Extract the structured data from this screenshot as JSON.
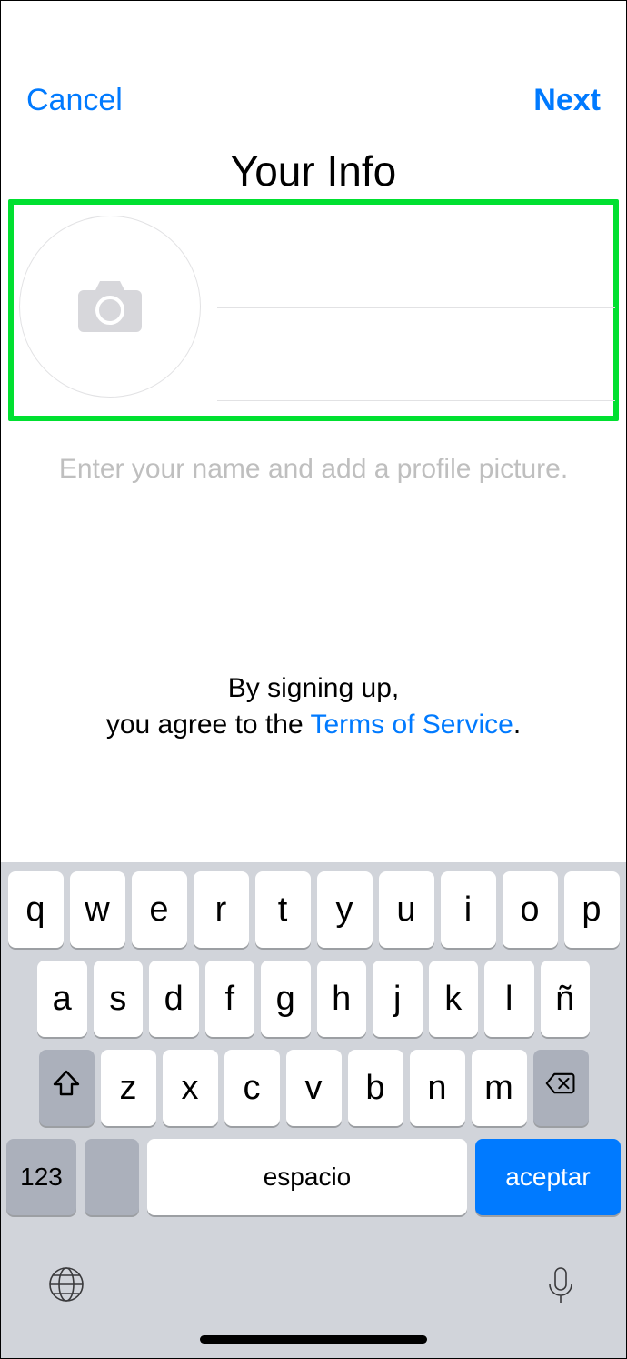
{
  "nav": {
    "cancel": "Cancel",
    "next": "Next"
  },
  "title": "Your Info",
  "fields": {
    "first_name": "",
    "last_name": ""
  },
  "hint": "Enter your name and add a profile picture.",
  "tos": {
    "line1": "By signing up,",
    "line2_prefix": "you agree to the ",
    "link": "Terms of Service",
    "suffix": "."
  },
  "keyboard": {
    "row1": [
      "q",
      "w",
      "e",
      "r",
      "t",
      "y",
      "u",
      "i",
      "o",
      "p"
    ],
    "row2": [
      "a",
      "s",
      "d",
      "f",
      "g",
      "h",
      "j",
      "k",
      "l",
      "ñ"
    ],
    "row3": [
      "z",
      "x",
      "c",
      "v",
      "b",
      "n",
      "m"
    ],
    "num": "123",
    "space": "espacio",
    "accept": "aceptar"
  }
}
